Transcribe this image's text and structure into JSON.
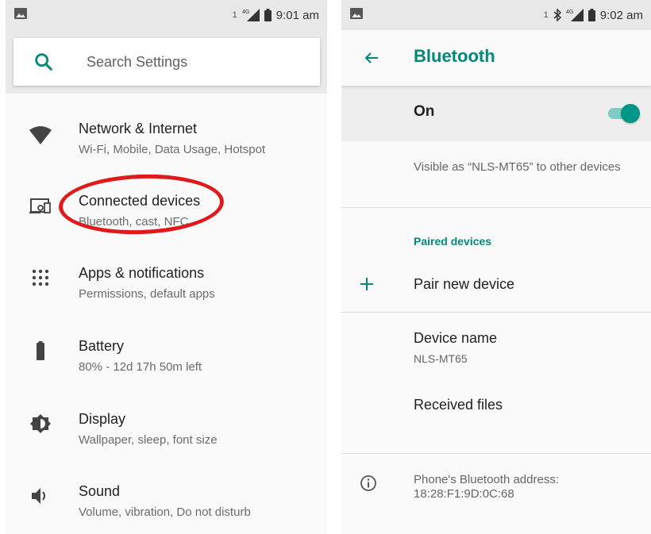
{
  "left_screen": {
    "status_bar": {
      "sim": "1",
      "network": "4G",
      "time": "9:01 am"
    },
    "search": {
      "placeholder": "Search Settings"
    },
    "items": [
      {
        "icon": "wifi-icon",
        "title": "Network & Internet",
        "subtitle": "Wi-Fi, Mobile, Data Usage, Hotspot"
      },
      {
        "icon": "devices-icon",
        "title": "Connected devices",
        "subtitle": "Bluetooth, cast, NFC"
      },
      {
        "icon": "apps-grid-icon",
        "title": "Apps & notifications",
        "subtitle": "Permissions, default apps"
      },
      {
        "icon": "battery-icon",
        "title": "Battery",
        "subtitle": "80% - 12d 17h 50m left"
      },
      {
        "icon": "brightness-icon",
        "title": "Display",
        "subtitle": "Wallpaper, sleep, font size"
      },
      {
        "icon": "volume-icon",
        "title": "Sound",
        "subtitle": "Volume, vibration, Do not disturb"
      }
    ],
    "highlight_color": "#e01a1a"
  },
  "right_screen": {
    "status_bar": {
      "sim": "1",
      "network": "4G",
      "time": "9:02 am"
    },
    "title": "Bluetooth",
    "toggle": {
      "label": "On",
      "checked": true
    },
    "visible_as": "Visible as “NLS-MT65” to other devices",
    "paired_header": "Paired devices",
    "pair_new": "Pair new device",
    "device_name": {
      "title": "Device name",
      "value": "NLS-MT65"
    },
    "received_files": "Received files",
    "address": {
      "label": "Phone's Bluetooth address:",
      "value": "18:28:F1:9D:0C:68"
    },
    "accent_color": "#00897b"
  }
}
